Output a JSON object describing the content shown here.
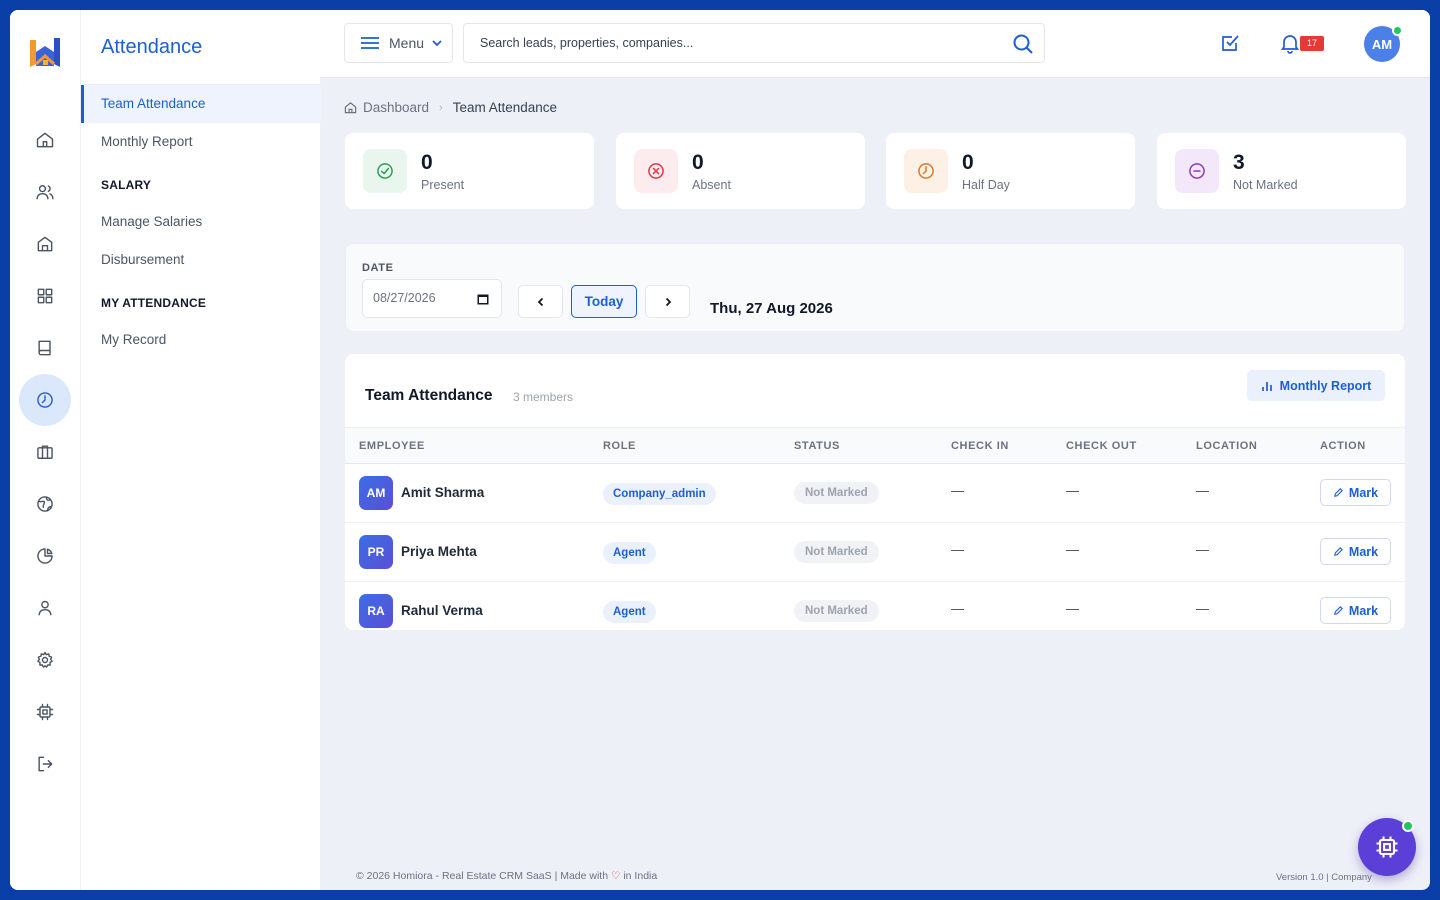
{
  "app": {
    "section_title": "Attendance"
  },
  "subnav": {
    "items": [
      {
        "label": "Team Attendance",
        "active": true
      },
      {
        "label": "Monthly Report",
        "active": false
      }
    ],
    "salary_heading": "SALARY",
    "salary_items": [
      {
        "label": "Manage Salaries"
      },
      {
        "label": "Disbursement"
      }
    ],
    "my_attendance_heading": "MY ATTENDANCE",
    "my_items": [
      {
        "label": "My Record"
      }
    ]
  },
  "rail": {
    "icons": [
      "dashboard-icon",
      "users-icon",
      "properties-icon",
      "grid-icon",
      "book-icon",
      "attendance-clock-icon",
      "briefcase-icon",
      "globe-icon",
      "pie-chart-icon",
      "profile-icon",
      "settings-icon",
      "chip-icon",
      "logout-icon"
    ],
    "active": "attendance-clock-icon"
  },
  "topbar": {
    "menu_label": "Menu",
    "search_placeholder": "Search leads, properties, companies...",
    "notification_count": "17",
    "avatar_initials": "AM"
  },
  "breadcrumb": {
    "root": "Dashboard",
    "current": "Team Attendance"
  },
  "stats": [
    {
      "value": "0",
      "label": "Present",
      "color": "#2e9e57",
      "bg": "#e8f6ee"
    },
    {
      "value": "0",
      "label": "Absent",
      "color": "#e0344a",
      "bg": "#fdecee"
    },
    {
      "value": "0",
      "label": "Half Day",
      "color": "#e0762a",
      "bg": "#fdf0e4"
    },
    {
      "value": "3",
      "label": "Not Marked",
      "color": "#8a3bb8",
      "bg": "#f3e8f9"
    }
  ],
  "date_filter": {
    "label": "DATE",
    "value": "08/27/2026",
    "today_label": "Today",
    "display_date": "Thu, 27 Aug 2026"
  },
  "team_table": {
    "title": "Team Attendance",
    "subtitle": "3 members",
    "report_button": "Monthly Report",
    "columns": [
      "EMPLOYEE",
      "ROLE",
      "STATUS",
      "CHECK IN",
      "CHECK OUT",
      "LOCATION",
      "ACTION"
    ],
    "rows": [
      {
        "initials": "AM",
        "name": "Amit Sharma",
        "role": "Company_admin",
        "status": "Not Marked",
        "check_in": "—",
        "check_out": "—",
        "location": "—",
        "action": "Mark"
      },
      {
        "initials": "PR",
        "name": "Priya Mehta",
        "role": "Agent",
        "status": "Not Marked",
        "check_in": "—",
        "check_out": "—",
        "location": "—",
        "action": "Mark"
      },
      {
        "initials": "RA",
        "name": "Rahul Verma",
        "role": "Agent",
        "status": "Not Marked",
        "check_in": "—",
        "check_out": "—",
        "location": "—",
        "action": "Mark"
      }
    ]
  },
  "footer": {
    "left_prefix": "© 2026 Homiora - Real Estate CRM SaaS | Made with",
    "left_suffix": "in India",
    "right": "Version 1.0 | Company"
  },
  "colors": {
    "accent": "#1d5fd3",
    "frame_bg": "#0b3fa8",
    "fab": "#5b3fd6"
  }
}
